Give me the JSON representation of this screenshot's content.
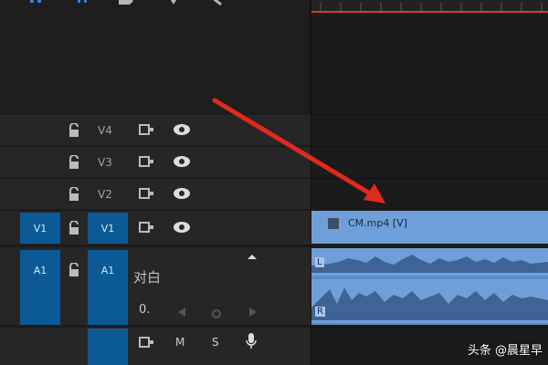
{
  "colors": {
    "accent": "#0b5a96",
    "clip": "#6f9fd8",
    "arrow": "#e0291f",
    "playhead": "#d43a2e"
  },
  "toolbar": {
    "icons": [
      "snap-icon",
      "marker-icon",
      "linked-selection-icon",
      "add-marker-icon",
      "wrench-icon"
    ]
  },
  "tracks": [
    {
      "id": "V4",
      "source": "",
      "type": "video"
    },
    {
      "id": "V3",
      "source": "",
      "type": "video"
    },
    {
      "id": "V2",
      "source": "",
      "type": "video"
    },
    {
      "id": "V1",
      "source": "V1",
      "type": "video"
    }
  ],
  "audio": {
    "source": "A1",
    "id": "A1",
    "name": "对白",
    "volume_knob": "0.",
    "buttons": {
      "mute": "M",
      "solo": "S"
    }
  },
  "clip": {
    "label": "CM.mp4 [V]"
  },
  "audio_clip": {
    "left_label": "L",
    "right_label": "R"
  },
  "watermark": {
    "text": "头条 @晨星早"
  }
}
